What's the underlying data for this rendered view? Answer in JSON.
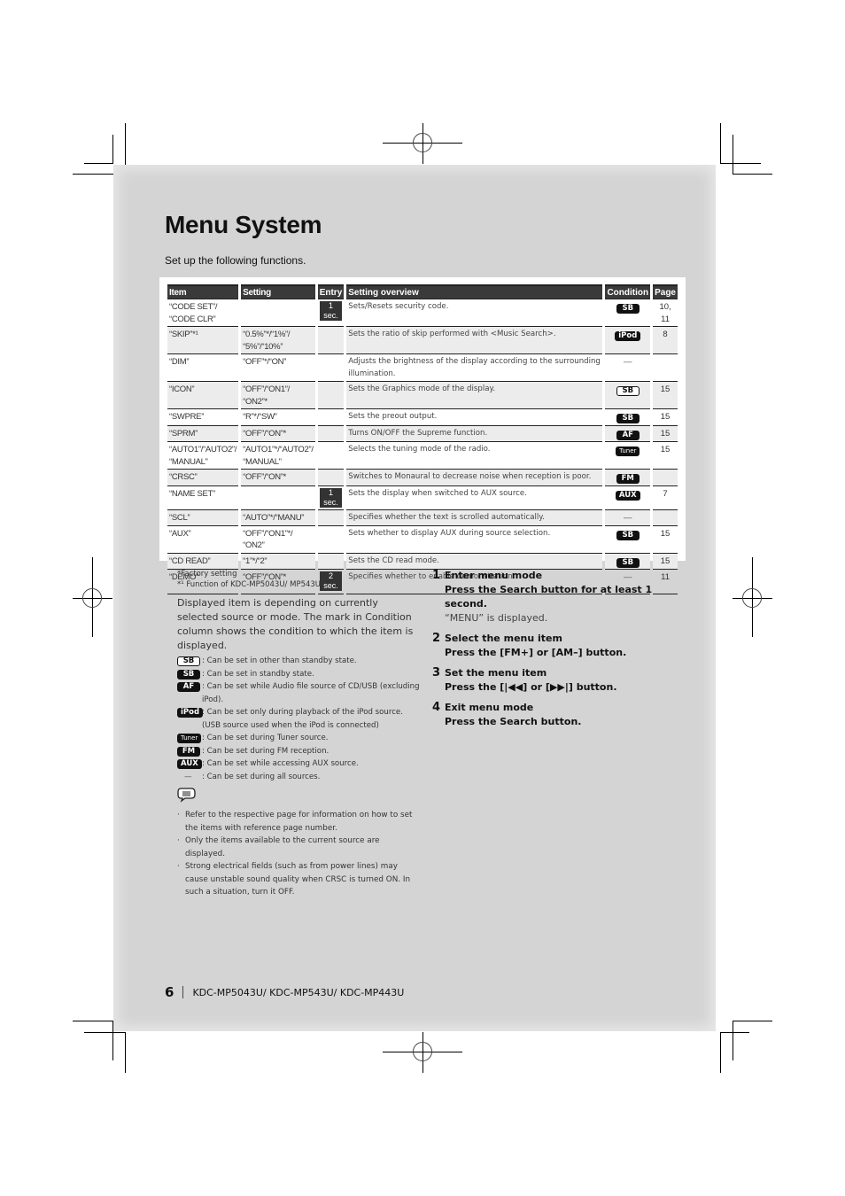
{
  "title": "Menu System",
  "subtitle": "Set up the following functions.",
  "table": {
    "headers": [
      "Item",
      "Setting",
      "Entry",
      "Setting overview",
      "Condition",
      "Page"
    ],
    "rows": [
      {
        "item": "“CODE SET”/ “CODE CLR”",
        "setting": "",
        "entry": "1 sec.",
        "overview": "Sets/Resets security code.",
        "condition": "SB",
        "condition_style": "solid",
        "page": "10, 11"
      },
      {
        "item": "“SKIP”*¹",
        "setting": "“0.5%”*/“1%”/ “5%”/“10%”",
        "entry": "",
        "overview": "Sets the ratio of skip performed with <Music Search>.",
        "condition": "iPod",
        "condition_style": "solid",
        "page": "8"
      },
      {
        "item": "“DIM”",
        "setting": "“OFF”*/“ON”",
        "entry": "",
        "overview": "Adjusts the brightness of the display according to the surrounding illumination.",
        "condition": "—",
        "condition_style": "dash",
        "page": ""
      },
      {
        "item": "“ICON”",
        "setting": "“OFF”/“ON1”/ “ON2”*",
        "entry": "",
        "overview": "Sets the Graphics mode of the display.",
        "condition": "SB",
        "condition_style": "outline",
        "page": "15"
      },
      {
        "item": "“SWPRE”",
        "setting": "“R”*/“SW”",
        "entry": "",
        "overview": "Sets the preout output.",
        "condition": "SB",
        "condition_style": "solid",
        "page": "15"
      },
      {
        "item": "“SPRM”",
        "setting": "“OFF”/“ON”*",
        "entry": "",
        "overview": "Turns ON/OFF the Supreme function.",
        "condition": "AF",
        "condition_style": "solid",
        "page": "15"
      },
      {
        "item": "“AUTO1”/“AUTO2”/ “MANUAL”",
        "setting": "“AUTO1”*/“AUTO2”/ “MANUAL”",
        "entry": "",
        "overview": "Selects the tuning mode of the radio.",
        "condition": "Tuner",
        "condition_style": "tuner",
        "page": "15"
      },
      {
        "item": "“CRSC”",
        "setting": "“OFF”/“ON”*",
        "entry": "",
        "overview": "Switches to Monaural to decrease noise when reception is poor.",
        "condition": "FM",
        "condition_style": "solid",
        "page": ""
      },
      {
        "item": "“NAME SET”",
        "setting": "",
        "entry": "1 sec.",
        "overview": "Sets the display when switched to AUX source.",
        "condition": "AUX",
        "condition_style": "solid",
        "page": "7"
      },
      {
        "item": "“SCL”",
        "setting": "“AUTO”*/“MANU”",
        "entry": "",
        "overview": "Specifies whether the text is scrolled automatically.",
        "condition": "—",
        "condition_style": "dash",
        "page": ""
      },
      {
        "item": "“AUX”",
        "setting": "“OFF”/“ON1”*/ “ON2”",
        "entry": "",
        "overview": "Sets whether to display AUX during source selection.",
        "condition": "SB",
        "condition_style": "solid",
        "page": "15"
      },
      {
        "item": "“CD READ”",
        "setting": "“1”*/“2”",
        "entry": "",
        "overview": "Sets the CD read mode.",
        "condition": "SB",
        "condition_style": "solid",
        "page": "15"
      },
      {
        "item": "“DEMO”",
        "setting": "“OFF”/“ON”*",
        "entry": "2 sec.",
        "overview": "Specifies whether to enable demonstration.",
        "condition": "—",
        "condition_style": "dash",
        "page": "11"
      }
    ]
  },
  "footnotes": {
    "factory": "*Factory setting",
    "function": "*¹ Function of KDC-MP5043U/ MP543U"
  },
  "description": "Displayed item is depending on currently selected source or mode. The mark in Condition column shows the condition to which the item is displayed.",
  "legend": [
    {
      "mark": "SB",
      "style": "outline",
      "text": ": Can be set in other than standby state."
    },
    {
      "mark": "SB",
      "style": "solid",
      "text": ": Can be set in standby state."
    },
    {
      "mark": "AF",
      "style": "solid",
      "text": ": Can be set while Audio file source of CD/USB (excluding iPod)."
    },
    {
      "mark": "iPod",
      "style": "solid",
      "text": ": Can be set only during playback of the iPod source. (USB source used when the iPod is connected)"
    },
    {
      "mark": "Tuner",
      "style": "tuner",
      "text": ": Can be set during Tuner source."
    },
    {
      "mark": "FM",
      "style": "solid",
      "text": ": Can be set during FM reception."
    },
    {
      "mark": "AUX",
      "style": "solid",
      "text": ": Can be set while accessing AUX source."
    },
    {
      "mark": "—",
      "style": "dash",
      "text": ": Can be set during all sources."
    }
  ],
  "notes": [
    "Refer to the respective page for information on how to set the items with reference page number.",
    "Only the items available to the current source are displayed.",
    "Strong electrical fields (such as from power lines) may cause unstable sound quality when CRSC is turned ON. In such a situation, turn it OFF."
  ],
  "steps": [
    {
      "num": "1",
      "title": "Enter menu mode",
      "action": "Press the Search button for at least 1 second.",
      "note": "“MENU” is displayed."
    },
    {
      "num": "2",
      "title": "Select the menu item",
      "action": "Press the [FM+] or [AM–] button.",
      "note": ""
    },
    {
      "num": "3",
      "title": "Set the menu item",
      "action": "Press the [|◀◀] or [▶▶|] button.",
      "note": ""
    },
    {
      "num": "4",
      "title": "Exit menu mode",
      "action": "Press the Search button.",
      "note": ""
    }
  ],
  "footer": {
    "page_number": "6",
    "models": "KDC-MP5043U/ KDC-MP543U/ KDC-MP443U"
  }
}
